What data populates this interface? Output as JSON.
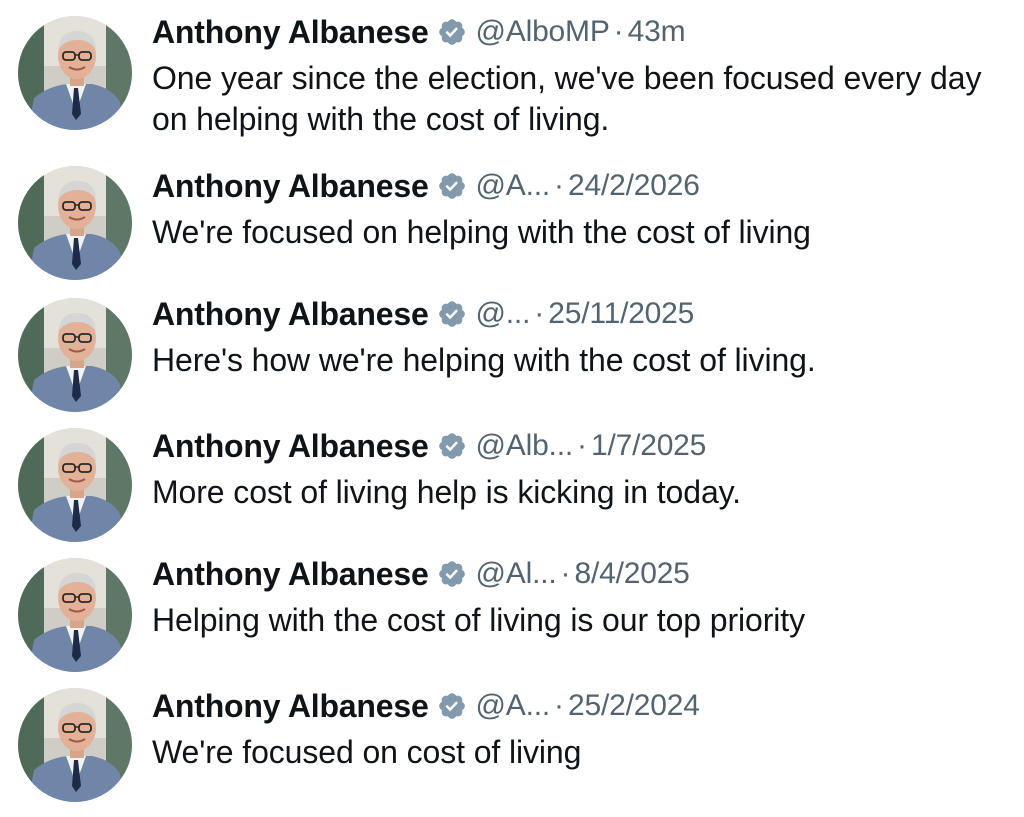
{
  "colors": {
    "text": "#0f1419",
    "secondary": "#536471",
    "verified": "#829aab",
    "background": "#ffffff"
  },
  "tweets": [
    {
      "name": "Anthony Albanese",
      "badge_icon": "verified-badge-icon",
      "handle": "@AlboMP",
      "separator": "·",
      "time": "43m",
      "text": "One year since the election, we've been focused every day on helping with the cost of living."
    },
    {
      "name": "Anthony Albanese",
      "badge_icon": "verified-badge-icon",
      "handle": "@A...",
      "separator": "·",
      "time": "24/2/2026",
      "text": "We're focused on helping with the cost of living"
    },
    {
      "name": "Anthony Albanese",
      "badge_icon": "verified-badge-icon",
      "handle": "@...",
      "separator": "·",
      "time": "25/11/2025",
      "text": "Here's how we're helping with the cost of living."
    },
    {
      "name": "Anthony Albanese",
      "badge_icon": "verified-badge-icon",
      "handle": "@Alb...",
      "separator": "·",
      "time": "1/7/2025",
      "text": "More cost of living help is kicking in today."
    },
    {
      "name": "Anthony Albanese",
      "badge_icon": "verified-badge-icon",
      "handle": "@Al...",
      "separator": "·",
      "time": "8/4/2025",
      "text": "Helping with the cost of living is our top priority"
    },
    {
      "name": "Anthony Albanese",
      "badge_icon": "verified-badge-icon",
      "handle": "@A...",
      "separator": "·",
      "time": "25/2/2024",
      "text": "We're focused on cost of living"
    }
  ]
}
